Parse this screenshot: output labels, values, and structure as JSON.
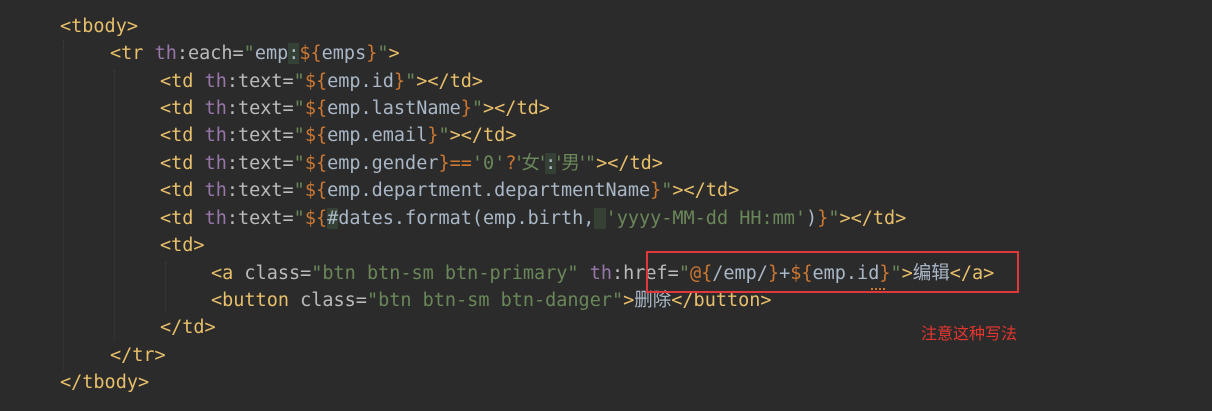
{
  "code": {
    "line1": "<tbody>",
    "line2": {
      "open": "<tr ",
      "th": "th",
      "attr": ":each=",
      "q1": "\"",
      "emp": "emp",
      "colon": ":",
      "expr_open": "${",
      "var": "emps",
      "expr_close": "}",
      "q2": "\"",
      "close": ">"
    },
    "line3": {
      "open": "<td ",
      "th": "th",
      "attr": ":text=",
      "q1": "\"",
      "expr_open": "${",
      "var": "emp.id",
      "expr_close": "}",
      "q2": "\"",
      "close": "></td>"
    },
    "line4": {
      "open": "<td ",
      "th": "th",
      "attr": ":text=",
      "q1": "\"",
      "expr_open": "${",
      "var": "emp.lastName",
      "expr_close": "}",
      "q2": "\"",
      "close": "></td>"
    },
    "line5": {
      "open": "<td ",
      "th": "th",
      "attr": ":text=",
      "q1": "\"",
      "expr_open": "${",
      "var": "emp.email",
      "expr_close": "}",
      "q2": "\"",
      "close": "></td>"
    },
    "line6": {
      "open": "<td ",
      "th": "th",
      "attr": ":text=",
      "q1": "\"",
      "expr_open": "${",
      "var": "emp.gender",
      "expr_close": "}",
      "op": "==",
      "s0": "'0'",
      "q": "?",
      "s1": "'女'",
      "c": ":",
      "s2": "'男'",
      "q2": "\"",
      "close": "></td>"
    },
    "line7": {
      "open": "<td ",
      "th": "th",
      "attr": ":text=",
      "q1": "\"",
      "expr_open": "${",
      "var": "emp.department.departmentName",
      "expr_close": "}",
      "q2": "\"",
      "close": "></td>"
    },
    "line8": {
      "open": "<td ",
      "th": "th",
      "attr": ":text=",
      "q1": "\"",
      "expr_open": "${",
      "hash": "#",
      "var": "dates.format(emp.birth,",
      "sp": " ",
      "fmt": "'yyyy-MM-dd HH:mm'",
      "paren": ")",
      "expr_close": "}",
      "q2": "\"",
      "close": "></td>"
    },
    "line9": "<td>",
    "line10": {
      "open": "<a ",
      "cls_attr": "class=",
      "cls_val": "\"btn btn-sm btn-primary\"",
      "sp": " ",
      "th": "th",
      "attr": ":href=",
      "q1": "\"",
      "url_open": "@{",
      "url": "/emp/",
      "url_close": "}",
      "plus": "+",
      "expr_open": "${",
      "var": "emp.id",
      "expr_close": "}",
      "q2": "\"",
      "gt": ">",
      "label": "编辑",
      "close": "</a>"
    },
    "line11": {
      "open": "<button ",
      "cls_attr": "class=",
      "cls_val": "\"btn btn-sm btn-danger\"",
      "gt": ">",
      "label": "删除",
      "close": "</button>"
    },
    "line12": "</td>",
    "line13": "</tr>",
    "line14": "</tbody>"
  },
  "annotation": {
    "note": "注意这种写法"
  },
  "colors": {
    "background": "#2b2b2b",
    "tag": "#e8bf6a",
    "string": "#6a8759",
    "keyword": "#cc7832",
    "thymeleaf": "#9876aa",
    "highlight_box": "#e0373a",
    "note": "#e6362f"
  }
}
